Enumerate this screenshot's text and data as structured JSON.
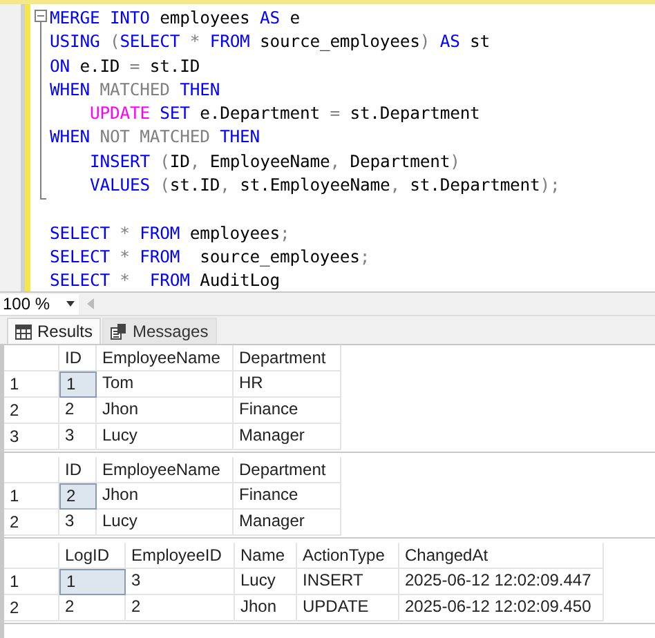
{
  "editor": {
    "statements": [
      {
        "lines": [
          {
            "indented": false,
            "tokens": [
              {
                "kind": "keyword",
                "text": "MERGE "
              },
              {
                "kind": "keyword",
                "text": "INTO"
              },
              {
                "kind": "plain",
                "text": " employees "
              },
              {
                "kind": "keyword",
                "text": "AS"
              },
              {
                "kind": "plain",
                "text": " e"
              }
            ]
          },
          {
            "indented": false,
            "tokens": [
              {
                "kind": "keyword",
                "text": "USING "
              },
              {
                "kind": "operator",
                "text": "("
              },
              {
                "kind": "keyword",
                "text": "SELECT "
              },
              {
                "kind": "operator",
                "text": "* "
              },
              {
                "kind": "keyword",
                "text": "FROM"
              },
              {
                "kind": "plain",
                "text": " source_employees"
              },
              {
                "kind": "operator",
                "text": ") "
              },
              {
                "kind": "keyword",
                "text": "AS"
              },
              {
                "kind": "plain",
                "text": " st"
              }
            ]
          },
          {
            "indented": false,
            "tokens": [
              {
                "kind": "keyword",
                "text": "ON"
              },
              {
                "kind": "plain",
                "text": " e.ID "
              },
              {
                "kind": "operator",
                "text": "="
              },
              {
                "kind": "plain",
                "text": " st.ID"
              }
            ]
          },
          {
            "indented": false,
            "tokens": [
              {
                "kind": "keyword",
                "text": "WHEN "
              },
              {
                "kind": "operator",
                "text": "MATCHED "
              },
              {
                "kind": "keyword",
                "text": "THEN"
              }
            ]
          },
          {
            "indented": true,
            "tokens": [
              {
                "kind": "function",
                "text": "UPDATE "
              },
              {
                "kind": "keyword",
                "text": "SET"
              },
              {
                "kind": "plain",
                "text": " e.Department "
              },
              {
                "kind": "operator",
                "text": "="
              },
              {
                "kind": "plain",
                "text": " st.Department"
              }
            ]
          },
          {
            "indented": false,
            "tokens": [
              {
                "kind": "keyword",
                "text": "WHEN "
              },
              {
                "kind": "operator",
                "text": "NOT MATCHED "
              },
              {
                "kind": "keyword",
                "text": "THEN"
              }
            ]
          },
          {
            "indented": true,
            "tokens": [
              {
                "kind": "keyword",
                "text": "INSERT "
              },
              {
                "kind": "operator",
                "text": "("
              },
              {
                "kind": "plain",
                "text": "ID"
              },
              {
                "kind": "operator",
                "text": ","
              },
              {
                "kind": "plain",
                "text": " EmployeeName"
              },
              {
                "kind": "operator",
                "text": ","
              },
              {
                "kind": "plain",
                "text": " Department"
              },
              {
                "kind": "operator",
                "text": ")"
              }
            ]
          },
          {
            "indented": true,
            "tokens": [
              {
                "kind": "keyword",
                "text": "VALUES "
              },
              {
                "kind": "operator",
                "text": "("
              },
              {
                "kind": "plain",
                "text": "st.ID"
              },
              {
                "kind": "operator",
                "text": ","
              },
              {
                "kind": "plain",
                "text": " st.EmployeeName"
              },
              {
                "kind": "operator",
                "text": ","
              },
              {
                "kind": "plain",
                "text": " st.Department"
              },
              {
                "kind": "operator",
                "text": ");"
              }
            ]
          }
        ]
      },
      {
        "lines": [
          {
            "indented": false,
            "tokens": [
              {
                "kind": "keyword",
                "text": "SELECT "
              },
              {
                "kind": "operator",
                "text": "* "
              },
              {
                "kind": "keyword",
                "text": "FROM"
              },
              {
                "kind": "plain",
                "text": " employees"
              },
              {
                "kind": "operator",
                "text": ";"
              }
            ]
          },
          {
            "indented": false,
            "tokens": [
              {
                "kind": "keyword",
                "text": "SELECT "
              },
              {
                "kind": "operator",
                "text": "* "
              },
              {
                "kind": "keyword",
                "text": "FROM"
              },
              {
                "kind": "plain",
                "text": "  source_employees"
              },
              {
                "kind": "operator",
                "text": ";"
              }
            ]
          },
          {
            "indented": false,
            "tokens": [
              {
                "kind": "keyword",
                "text": "SELECT "
              },
              {
                "kind": "operator",
                "text": "*  "
              },
              {
                "kind": "keyword",
                "text": "FROM"
              },
              {
                "kind": "plain",
                "text": " AuditLog"
              }
            ]
          }
        ]
      }
    ]
  },
  "zoom": {
    "value": "100 %"
  },
  "tabs": [
    {
      "label": "Results",
      "selected": true,
      "kind": "grid"
    },
    {
      "label": "Messages",
      "selected": false,
      "kind": "messages"
    }
  ],
  "grids": [
    {
      "columns": [
        "ID",
        "EmployeeName",
        "Department"
      ],
      "rows": [
        {
          "number": "1",
          "selected": true,
          "cells": [
            "1",
            "Tom",
            "HR"
          ]
        },
        {
          "number": "2",
          "selected": false,
          "cells": [
            "2",
            "Jhon",
            "Finance"
          ]
        },
        {
          "number": "3",
          "selected": false,
          "cells": [
            "3",
            "Lucy",
            "Manager"
          ]
        }
      ]
    },
    {
      "columns": [
        "ID",
        "EmployeeName",
        "Department"
      ],
      "rows": [
        {
          "number": "1",
          "selected": true,
          "cells": [
            "2",
            "Jhon",
            "Finance"
          ]
        },
        {
          "number": "2",
          "selected": false,
          "cells": [
            "3",
            "Lucy",
            "Manager"
          ]
        }
      ]
    },
    {
      "columns": [
        "LogID",
        "EmployeeID",
        "Name",
        "ActionType",
        "ChangedAt"
      ],
      "rows": [
        {
          "number": "1",
          "selected": true,
          "cells": [
            "1",
            "3",
            "Lucy",
            "INSERT",
            "2025-06-12 12:02:09.447"
          ]
        },
        {
          "number": "2",
          "selected": false,
          "cells": [
            "2",
            "2",
            "Jhon",
            "UPDATE",
            "2025-06-12 12:02:09.450"
          ]
        }
      ]
    }
  ]
}
